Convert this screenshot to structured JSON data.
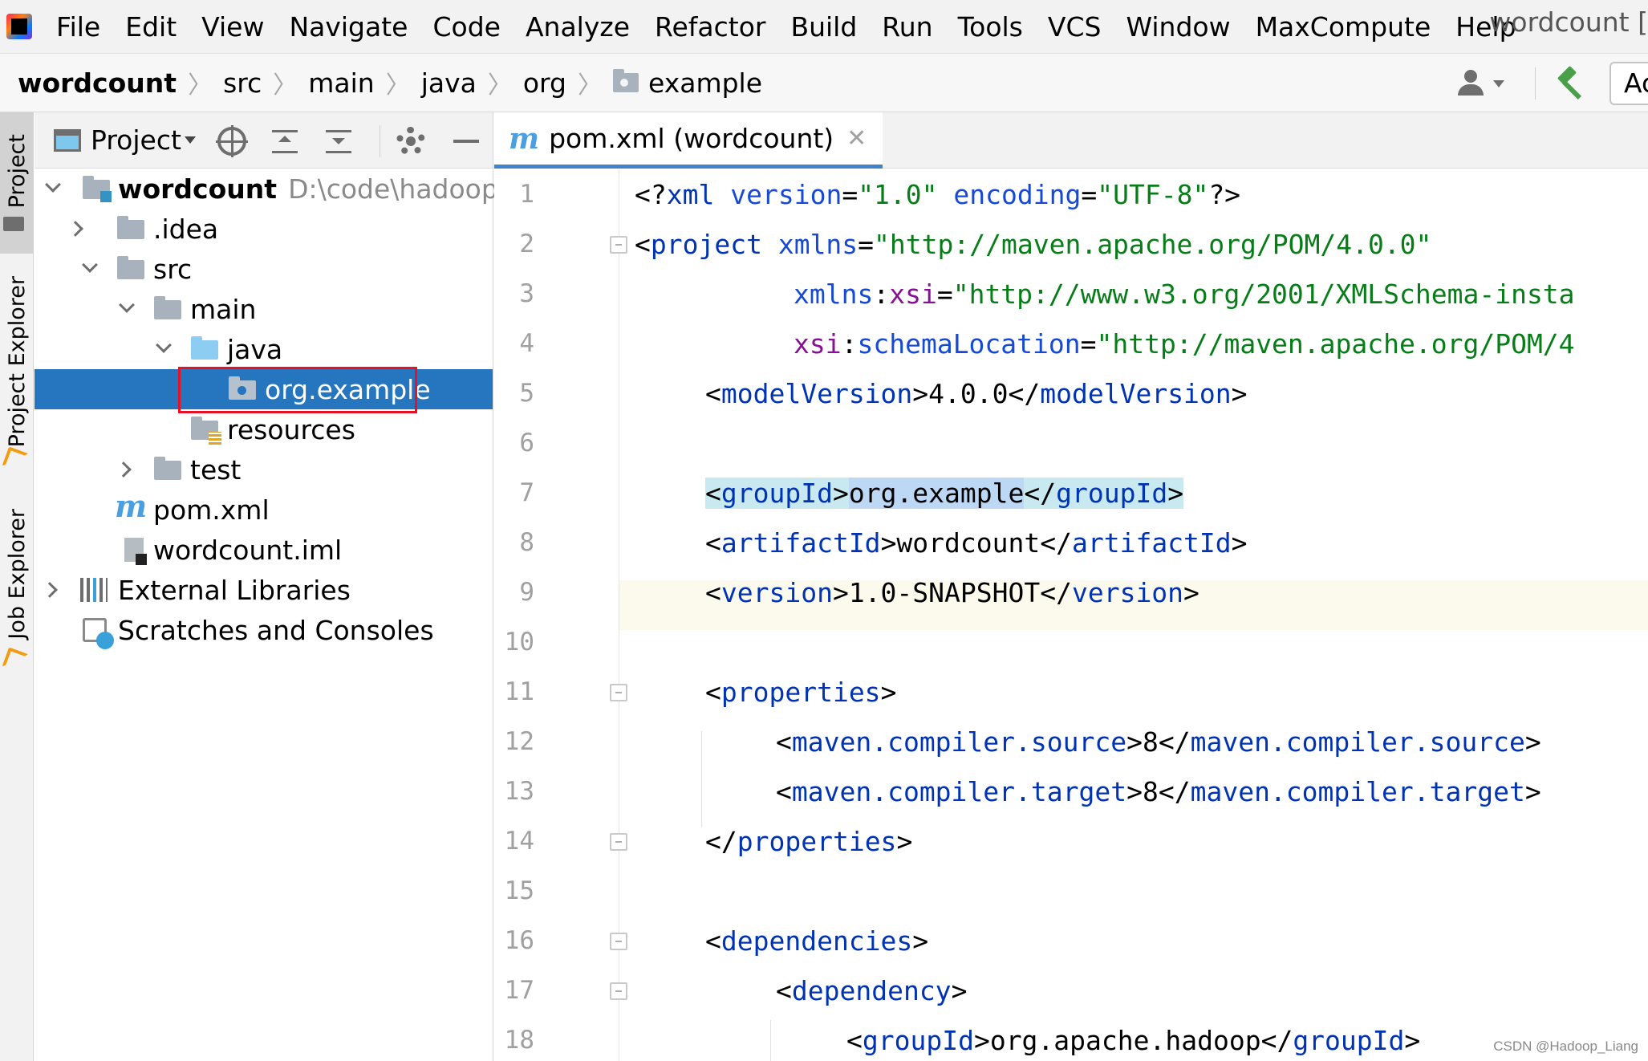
{
  "menubar": {
    "items": [
      "File",
      "Edit",
      "View",
      "Navigate",
      "Code",
      "Analyze",
      "Refactor",
      "Build",
      "Run",
      "Tools",
      "VCS",
      "Window",
      "MaxCompute",
      "Help"
    ],
    "window_title": "wordcount ["
  },
  "navbar": {
    "breadcrumbs": [
      "wordcount",
      "src",
      "main",
      "java",
      "org",
      "example"
    ],
    "run_config_label": "Ac"
  },
  "left_stripe": {
    "project": "Project",
    "project_explorer": "Project Explorer",
    "job_explorer": "Job Explorer"
  },
  "project_panel": {
    "title": "Project",
    "tree": [
      {
        "label": "wordcount",
        "path": "D:\\code\\hadoop\\r"
      },
      {
        "label": ".idea"
      },
      {
        "label": "src"
      },
      {
        "label": "main"
      },
      {
        "label": "java"
      },
      {
        "label": "org.example"
      },
      {
        "label": "resources"
      },
      {
        "label": "test"
      },
      {
        "label": "pom.xml"
      },
      {
        "label": "wordcount.iml"
      },
      {
        "label": "External Libraries"
      },
      {
        "label": "Scratches and Consoles"
      }
    ]
  },
  "editor": {
    "tab_label": "pom.xml (wordcount)",
    "tab_icon": "m",
    "line_numbers": [
      "1",
      "2",
      "3",
      "4",
      "5",
      "6",
      "7",
      "8",
      "9",
      "10",
      "11",
      "12",
      "13",
      "14",
      "15",
      "16",
      "17",
      "18"
    ],
    "lines": {
      "l1": {
        "a": "<?",
        "b": "xml",
        "c": " ",
        "d": "version",
        "e": "=",
        "f": "\"1.0\"",
        "g": " ",
        "h": "encoding",
        "i": "=",
        "j": "\"UTF-8\"",
        "k": "?>"
      },
      "l2": {
        "a": "<",
        "b": "project",
        "c": " ",
        "d": "xmlns",
        "e": "=",
        "f": "\"http://maven.apache.org/POM/4.0.0\""
      },
      "l3": {
        "a": "xmlns",
        "b": ":",
        "c": "xsi",
        "d": "=",
        "e": "\"http://www.w3.org/2001/XMLSchema-insta"
      },
      "l4": {
        "a": "xsi",
        "b": ":",
        "c": "schemaLocation",
        "d": "=",
        "e": "\"http://maven.apache.org/POM/4"
      },
      "l5": {
        "a": "<",
        "b": "modelVersion",
        "c": ">4.0.0</",
        "d": "modelVersion",
        "e": ">"
      },
      "l7": {
        "a": "<",
        "b": "groupId",
        "c": ">",
        "d": "org.example",
        "e": "</",
        "f": "groupId",
        "g": ">"
      },
      "l8": {
        "a": "<",
        "b": "artifactId",
        "c": ">wordcount</",
        "d": "artifactId",
        "e": ">"
      },
      "l9": {
        "a": "<",
        "b": "version",
        "c": ">1.0-SNAPSHOT</",
        "d": "version",
        "e": ">"
      },
      "l11": {
        "a": "<",
        "b": "properties",
        "c": ">"
      },
      "l12": {
        "a": "<",
        "b": "maven.compiler.source",
        "c": ">8</",
        "d": "maven.compiler.source",
        "e": ">"
      },
      "l13": {
        "a": "<",
        "b": "maven.compiler.target",
        "c": ">8</",
        "d": "maven.compiler.target",
        "e": ">"
      },
      "l14": {
        "a": "</",
        "b": "properties",
        "c": ">"
      },
      "l16": {
        "a": "<",
        "b": "dependencies",
        "c": ">"
      },
      "l17": {
        "a": "<",
        "b": "dependency",
        "c": ">"
      },
      "l18": {
        "a": "<",
        "b": "groupId",
        "c": ">org.apache.hadoop</",
        "d": "groupId",
        "e": ">"
      }
    }
  },
  "watermark": "CSDN @Hadoop_Liang",
  "colors": {
    "selection": "#2675bf",
    "tag": "#0033b3",
    "attr_value": "#067d17",
    "namespace": "#871094",
    "highlight_box": "#e81123"
  }
}
